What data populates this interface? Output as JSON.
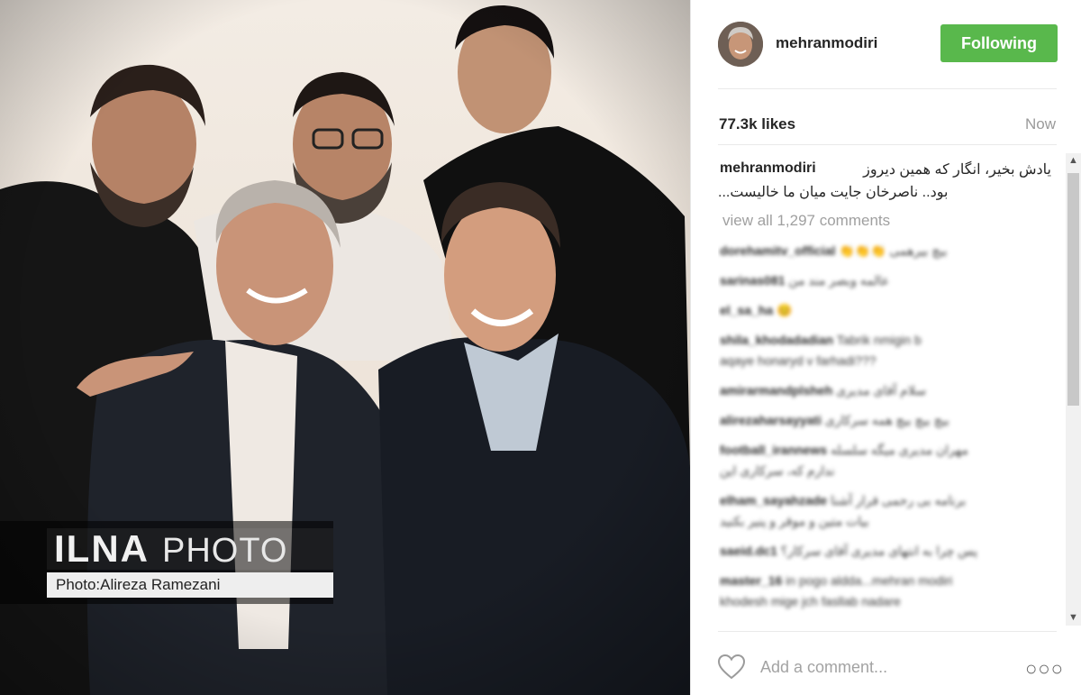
{
  "watermark": {
    "brand": "ILNA",
    "label": "PHOTO",
    "credit": "Photo:Alireza Ramezani"
  },
  "post": {
    "username": "mehranmodiri",
    "follow_label": "Following",
    "likes": "77.3k likes",
    "time": "Now",
    "caption_user": "mehranmodiri",
    "caption_line1": "یادش بخیر، انگار که همین دیروز",
    "caption_line2": "...بود.. ناصرخان جایت میان ما خالیست",
    "view_all": "view all 1,297 comments"
  },
  "comments": [
    {
      "user": "dorehamitv_official",
      "text": "👏👏👏 بیچ بیرهمی"
    },
    {
      "user": "sarinas081",
      "text": "عالمه وبصر مند من"
    },
    {
      "user": "el_sa_ha",
      "text": "😊"
    },
    {
      "user": "shila_khodadadian",
      "text": "Tabrik nmigin b",
      "text2": "aqaye honaryd v farhadi???"
    },
    {
      "user": "amirarmandplsheh",
      "text": "سلام آقای مدیری"
    },
    {
      "user": "alirezaharsayyati",
      "text": "بیچ بیچ بیچ همه سرکاری"
    },
    {
      "user": "football_irannews",
      "text": "مهران مدیری میگه سلسله",
      "text2": "ندارم که، سرکاری این"
    },
    {
      "user": "elham_sayahzade",
      "text": "برنامه بی رحمی قرار آشنا",
      "text2": "بیات متین و موقر و پنیر بکنید"
    },
    {
      "user": "saeid.dc1",
      "text": "پس چرا به انتهای مدیری آقای سرکار؟"
    },
    {
      "user": "master_16",
      "text": "in pogo aldda...mehran modiri",
      "text2": "khodesh mige jch fasllab nadare"
    }
  ],
  "input": {
    "placeholder": "Add a comment..."
  },
  "icons": {
    "heart": "heart-icon",
    "more": "more-options-icon",
    "scroll_up": "scroll-up-icon",
    "scroll_down": "scroll-down-icon"
  },
  "colors": {
    "follow_bg": "#59b84c",
    "username": "#262626",
    "muted": "#9a9a9a"
  }
}
